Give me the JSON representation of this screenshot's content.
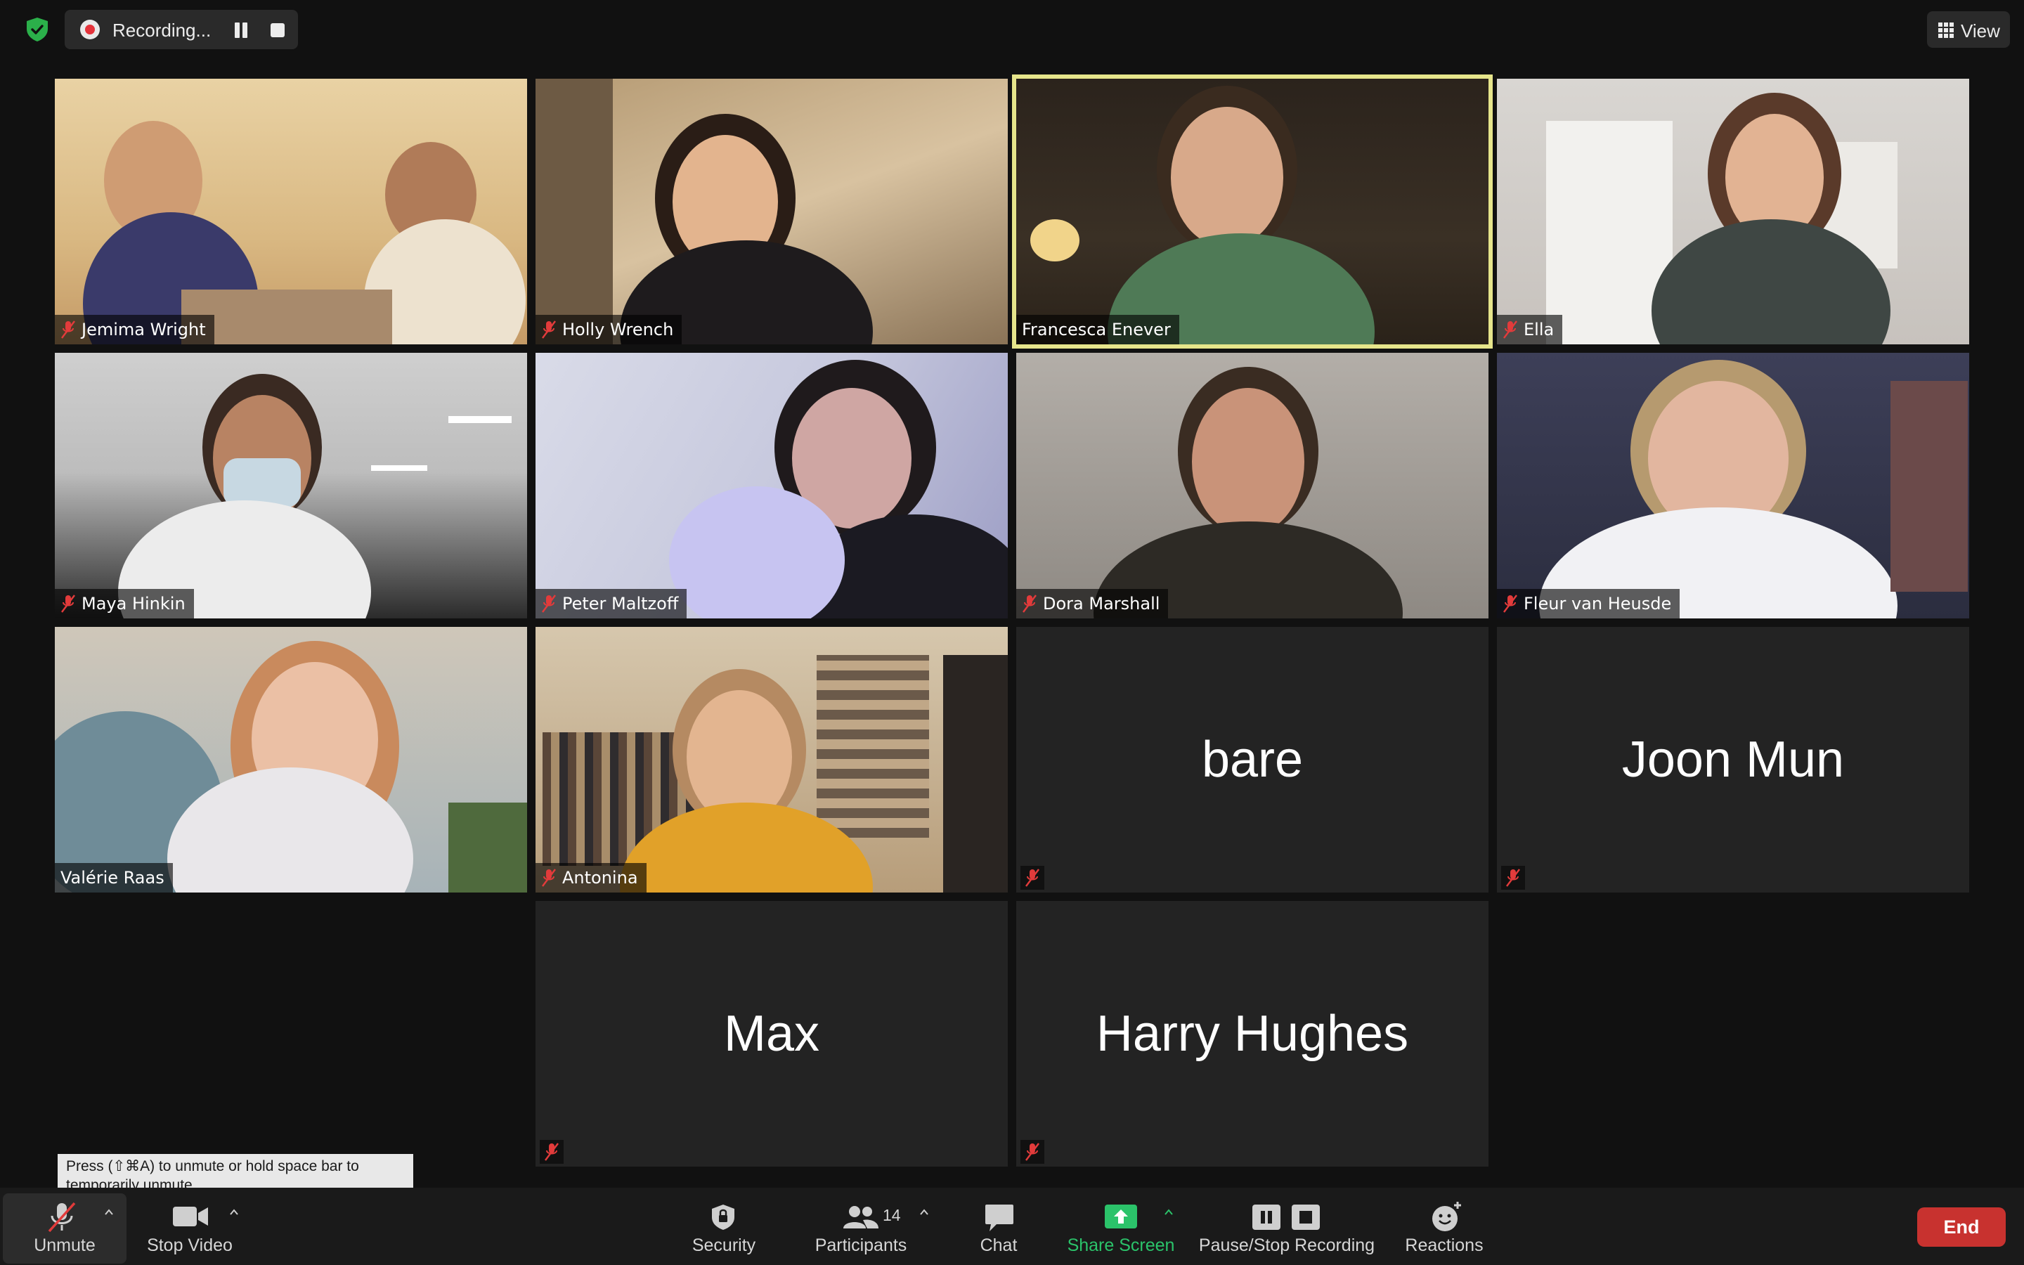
{
  "top_bar": {
    "recording_label": "Recording...",
    "view_label": "View"
  },
  "participants": [
    {
      "name": "Jemima Wright",
      "muted": true,
      "video": true,
      "active": false
    },
    {
      "name": "Holly Wrench",
      "muted": true,
      "video": true,
      "active": false
    },
    {
      "name": "Francesca Enever",
      "muted": false,
      "video": true,
      "active": true
    },
    {
      "name": "Ella",
      "muted": true,
      "video": true,
      "active": false
    },
    {
      "name": "Maya Hinkin",
      "muted": true,
      "video": true,
      "active": false
    },
    {
      "name": "Peter Maltzoff",
      "muted": true,
      "video": true,
      "active": false
    },
    {
      "name": "Dora Marshall",
      "muted": true,
      "video": true,
      "active": false
    },
    {
      "name": "Fleur van Heusde",
      "muted": true,
      "video": true,
      "active": false
    },
    {
      "name": "Valérie Raas",
      "muted": false,
      "video": true,
      "active": false
    },
    {
      "name": "Antonina",
      "muted": true,
      "video": true,
      "active": false
    },
    {
      "name": "bare",
      "muted": true,
      "video": false,
      "active": false
    },
    {
      "name": "Joon Mun",
      "muted": true,
      "video": false,
      "active": false
    },
    {
      "name": "Max",
      "muted": true,
      "video": false,
      "active": false
    },
    {
      "name": "Harry Hughes",
      "muted": true,
      "video": false,
      "active": false
    }
  ],
  "tooltip": {
    "line1": "Press  (⇧⌘A) to unmute or hold space bar to",
    "line2": "temporarily unmute."
  },
  "toolbar": {
    "unmute_label": "Unmute",
    "stop_video_label": "Stop Video",
    "security_label": "Security",
    "participants_label": "Participants",
    "participants_count": "14",
    "chat_label": "Chat",
    "share_screen_label": "Share Screen",
    "pause_stop_label": "Pause/Stop Recording",
    "reactions_label": "Reactions",
    "end_label": "End"
  },
  "colors": {
    "active_speaker_border": "#e6e58b",
    "share_screen_green": "#2bc36a",
    "end_button_red": "#c8322f",
    "recording_red": "#e5333b",
    "shield_green": "#2bb04a"
  }
}
